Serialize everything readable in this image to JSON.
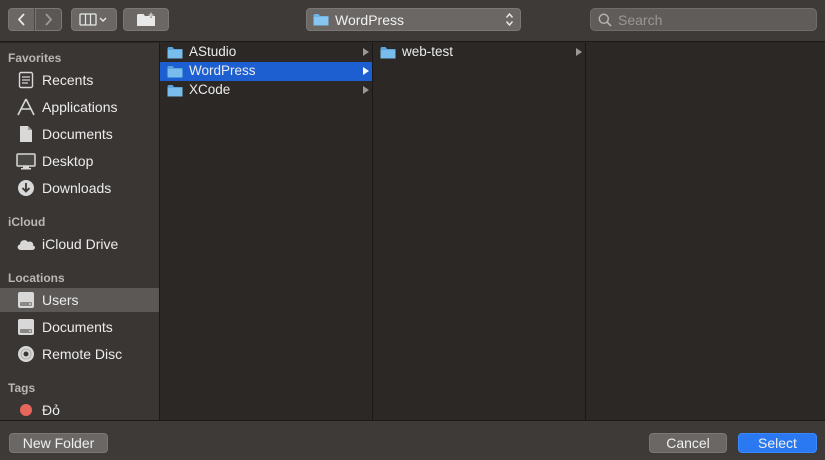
{
  "toolbar": {
    "path_popup": {
      "label": "WordPress",
      "icon": "folder-icon"
    },
    "search": {
      "placeholder": "Search"
    }
  },
  "sidebar": {
    "sections": [
      {
        "title": "Favorites",
        "items": [
          {
            "label": "Recents",
            "icon": "clock-document-icon"
          },
          {
            "label": "Applications",
            "icon": "applications-icon"
          },
          {
            "label": "Documents",
            "icon": "document-icon"
          },
          {
            "label": "Desktop",
            "icon": "desktop-icon"
          },
          {
            "label": "Downloads",
            "icon": "download-icon"
          }
        ]
      },
      {
        "title": "iCloud",
        "items": [
          {
            "label": "iCloud Drive",
            "icon": "cloud-icon"
          }
        ]
      },
      {
        "title": "Locations",
        "items": [
          {
            "label": "Users",
            "icon": "disk-icon",
            "selected": true
          },
          {
            "label": "Documents",
            "icon": "disk-icon"
          },
          {
            "label": "Remote Disc",
            "icon": "disc-icon"
          }
        ]
      },
      {
        "title": "Tags",
        "items": [
          {
            "label": "Đỏ",
            "icon": "red-tag-dot",
            "color": "#e8675c"
          }
        ]
      }
    ]
  },
  "columns": [
    {
      "items": [
        {
          "label": "AStudio",
          "has_children": true
        },
        {
          "label": "WordPress",
          "has_children": true,
          "selected": true
        },
        {
          "label": "XCode",
          "has_children": true
        }
      ]
    },
    {
      "items": [
        {
          "label": "web-test",
          "has_children": true
        }
      ]
    },
    {
      "items": []
    }
  ],
  "footer": {
    "new_folder": "New Folder",
    "cancel": "Cancel",
    "select": "Select"
  },
  "colors": {
    "accent": "#2a78f2",
    "selection": "#1d5fd1",
    "folder": "#6cb5e8",
    "tag_red": "#e8675c"
  }
}
